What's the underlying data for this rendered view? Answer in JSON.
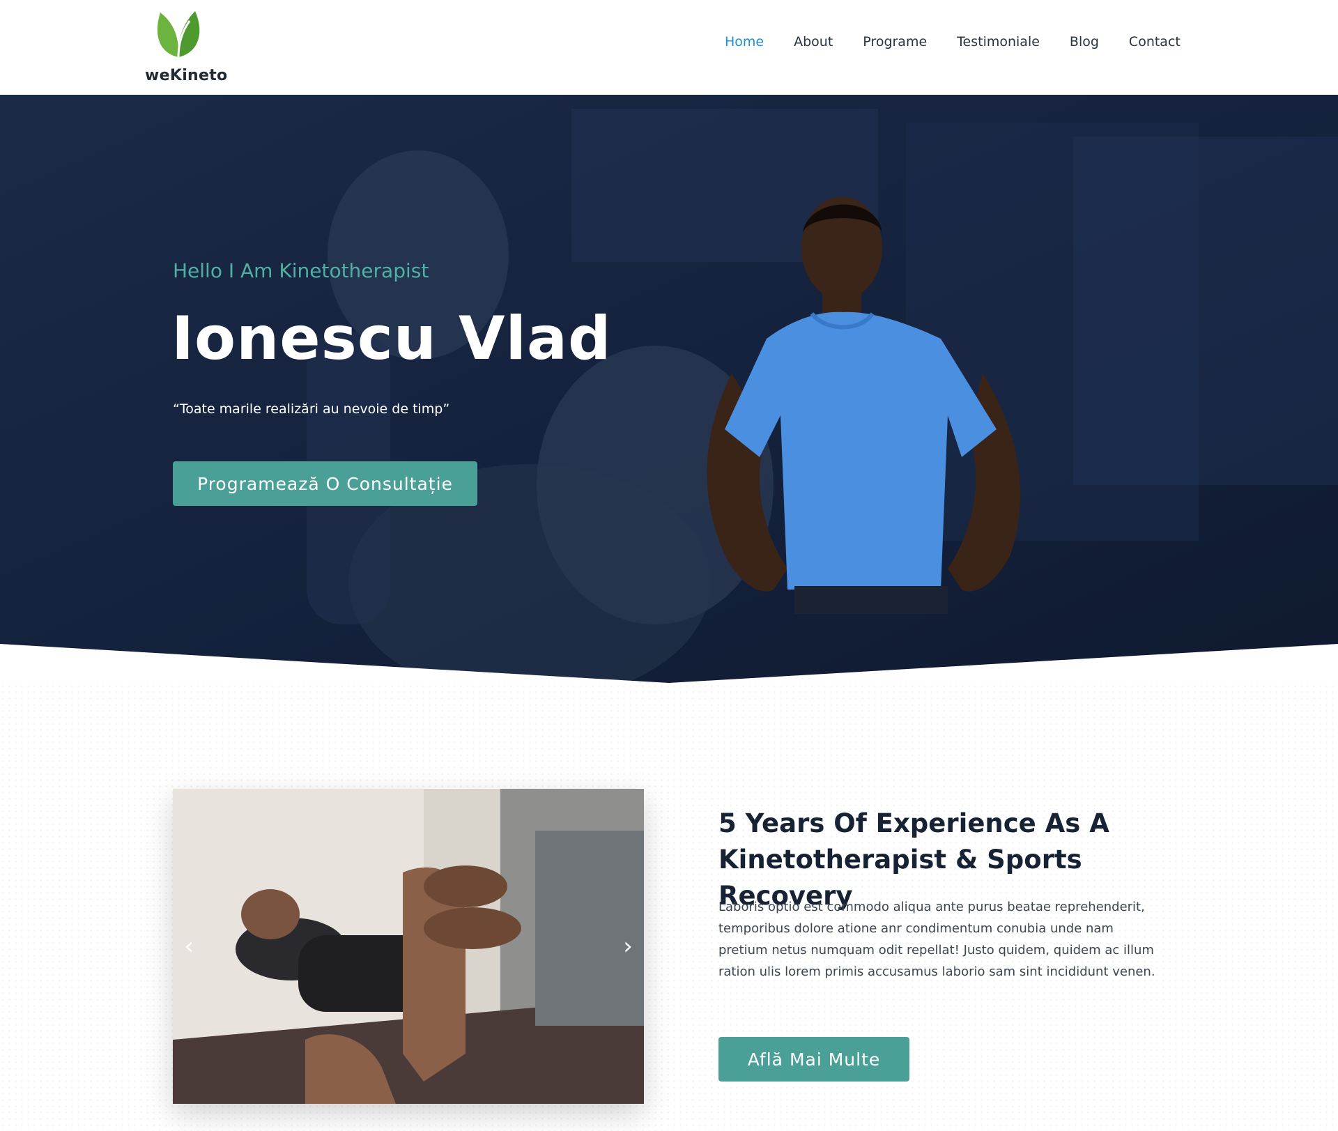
{
  "header": {
    "brand": "weKineto",
    "nav": [
      {
        "label": "Home",
        "active": true
      },
      {
        "label": "About",
        "active": false
      },
      {
        "label": "Programe",
        "active": false
      },
      {
        "label": "Testimoniale",
        "active": false
      },
      {
        "label": "Blog",
        "active": false
      },
      {
        "label": "Contact",
        "active": false
      }
    ]
  },
  "hero": {
    "subtitle": "Hello I Am Kinetotherapist",
    "title": "Ionescu Vlad",
    "quote": "“Toate marile realizări au nevoie de timp”",
    "cta_label": "Programează O Consultație"
  },
  "about": {
    "title": "5 Years Of Experience As A Kinetotherapist & Sports Recovery",
    "text": "Laboris optio est commodo aliqua ante purus beatae reprehenderit, temporibus dolore atione anr condimentum conubia unde nam pretium  netus numquam odit repellat! Justo quidem, quidem ac illum ration ulis lorem primis accusamus laborio sam sint incididunt venen.",
    "cta_label": "Află Mai Multe",
    "slider": {
      "prev_icon": "chevron-left-icon",
      "next_icon": "chevron-right-icon",
      "prev_glyph": "‹",
      "next_glyph": "›"
    }
  },
  "colors": {
    "accent": "#4a9f97",
    "nav_active": "#1f8fd6",
    "hero_bg": "#14213a",
    "subtitle": "#4fb0a4"
  }
}
